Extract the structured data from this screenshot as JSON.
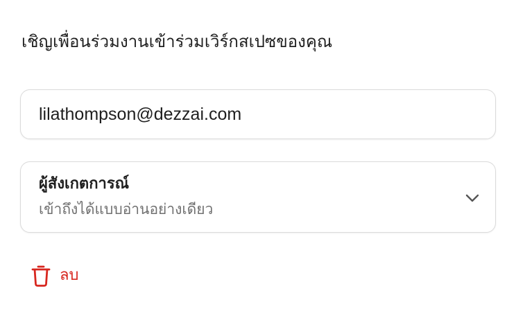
{
  "title": "เชิญเพื่อนร่วมงานเข้าร่วมเวิร์กสเปซของคุณ",
  "email_field": {
    "value": "lilathompson@dezzai.com"
  },
  "role_select": {
    "selected_label": "ผู้สังเกตการณ์",
    "selected_description": "เข้าถึงได้แบบอ่านอย่างเดียว",
    "icon": "chevron-down-icon"
  },
  "delete_button": {
    "label": "ลบ",
    "icon": "trash-icon",
    "color": "#d7261e"
  }
}
